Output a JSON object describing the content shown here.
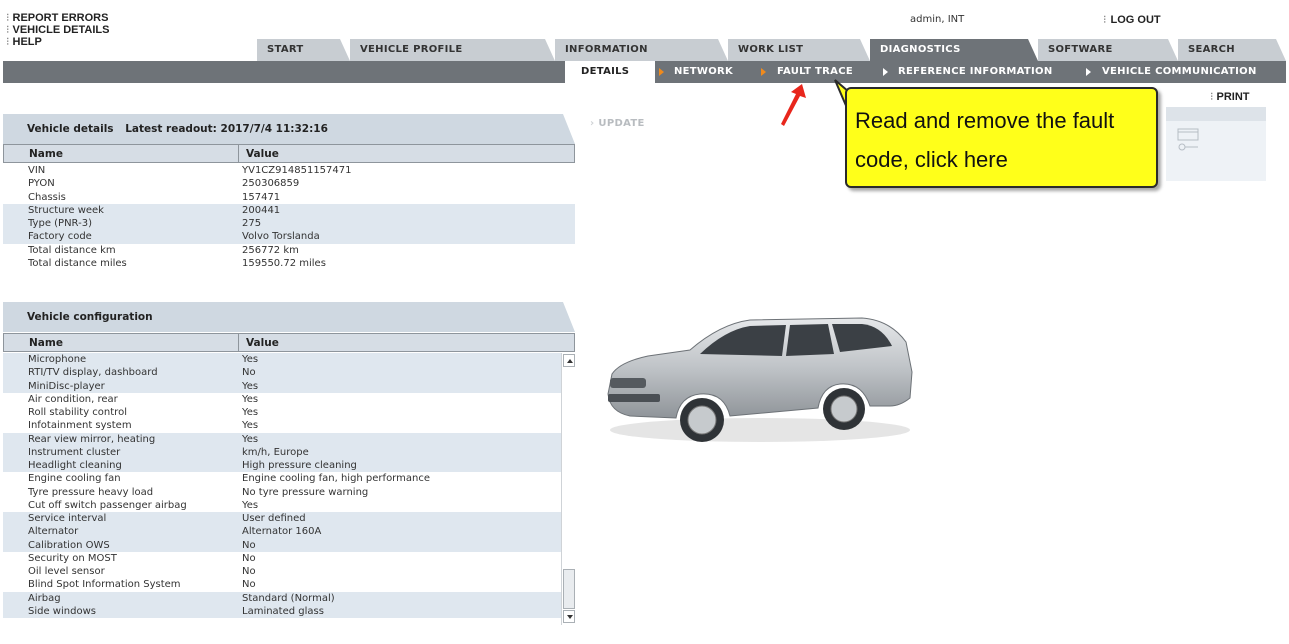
{
  "top_links": [
    "REPORT ERRORS",
    "VEHICLE DETAILS",
    "HELP"
  ],
  "user": "admin, INT",
  "logout_label": "LOG OUT",
  "main_tabs": [
    "START",
    "VEHICLE PROFILE",
    "INFORMATION",
    "WORK LIST",
    "DIAGNOSTICS",
    "SOFTWARE",
    "SEARCH"
  ],
  "active_tab": "DIAGNOSTICS",
  "sub_tabs": [
    "DETAILS",
    "NETWORK",
    "FAULT TRACE",
    "REFERENCE INFORMATION",
    "VEHICLE COMMUNICATION"
  ],
  "active_sub_tab": "DETAILS",
  "print_label": "PRINT",
  "update_label": "UPDATE",
  "vehicle_details": {
    "title": "Vehicle details",
    "readout": "Latest readout: 2017/7/4 11:32:16",
    "col_name": "Name",
    "col_value": "Value",
    "rows": [
      {
        "name": "VIN",
        "value": "YV1CZ914851157471"
      },
      {
        "name": "PYON",
        "value": "250306859"
      },
      {
        "name": "Chassis",
        "value": "157471"
      },
      {
        "name": "Structure week",
        "value": "200441"
      },
      {
        "name": "Type (PNR-3)",
        "value": "275"
      },
      {
        "name": "Factory code",
        "value": "Volvo Torslanda"
      },
      {
        "name": "Total distance km",
        "value": "256772 km"
      },
      {
        "name": "Total distance miles",
        "value": "159550.72 miles"
      }
    ]
  },
  "vehicle_configuration": {
    "title": "Vehicle configuration",
    "col_name": "Name",
    "col_value": "Value",
    "rows": [
      {
        "name": "Microphone",
        "value": "Yes"
      },
      {
        "name": "RTI/TV display, dashboard",
        "value": "No"
      },
      {
        "name": "MiniDisc-player",
        "value": "Yes"
      },
      {
        "name": "Air condition, rear",
        "value": "Yes"
      },
      {
        "name": "Roll stability control",
        "value": "Yes"
      },
      {
        "name": "Infotainment system",
        "value": "Yes"
      },
      {
        "name": "Rear view mirror, heating",
        "value": "Yes"
      },
      {
        "name": "Instrument cluster",
        "value": "km/h, Europe"
      },
      {
        "name": "Headlight cleaning",
        "value": "High pressure cleaning"
      },
      {
        "name": "Engine cooling fan",
        "value": "Engine cooling fan, high performance"
      },
      {
        "name": "Tyre pressure heavy load",
        "value": "No tyre pressure warning"
      },
      {
        "name": "Cut off switch passenger airbag",
        "value": "Yes"
      },
      {
        "name": "Service interval",
        "value": "User defined"
      },
      {
        "name": "Alternator",
        "value": "Alternator 160A"
      },
      {
        "name": "Calibration OWS",
        "value": "No"
      },
      {
        "name": "Security on MOST",
        "value": "No"
      },
      {
        "name": "Oil level sensor",
        "value": "No"
      },
      {
        "name": "Blind Spot Information System",
        "value": "No"
      },
      {
        "name": "Airbag",
        "value": "Standard (Normal)"
      },
      {
        "name": "Side windows",
        "value": "Laminated glass"
      }
    ]
  },
  "callout_lines": [
    "Read and remove the fault",
    "code, click here"
  ],
  "colors": {
    "tab_bg": "#c8cdd2",
    "nav_dark": "#6e7378",
    "row_shade": "#dfe7ef",
    "callout": "#ffff1a",
    "arrow_orange": "#f08a1c",
    "red_arrow": "#e8261c"
  }
}
